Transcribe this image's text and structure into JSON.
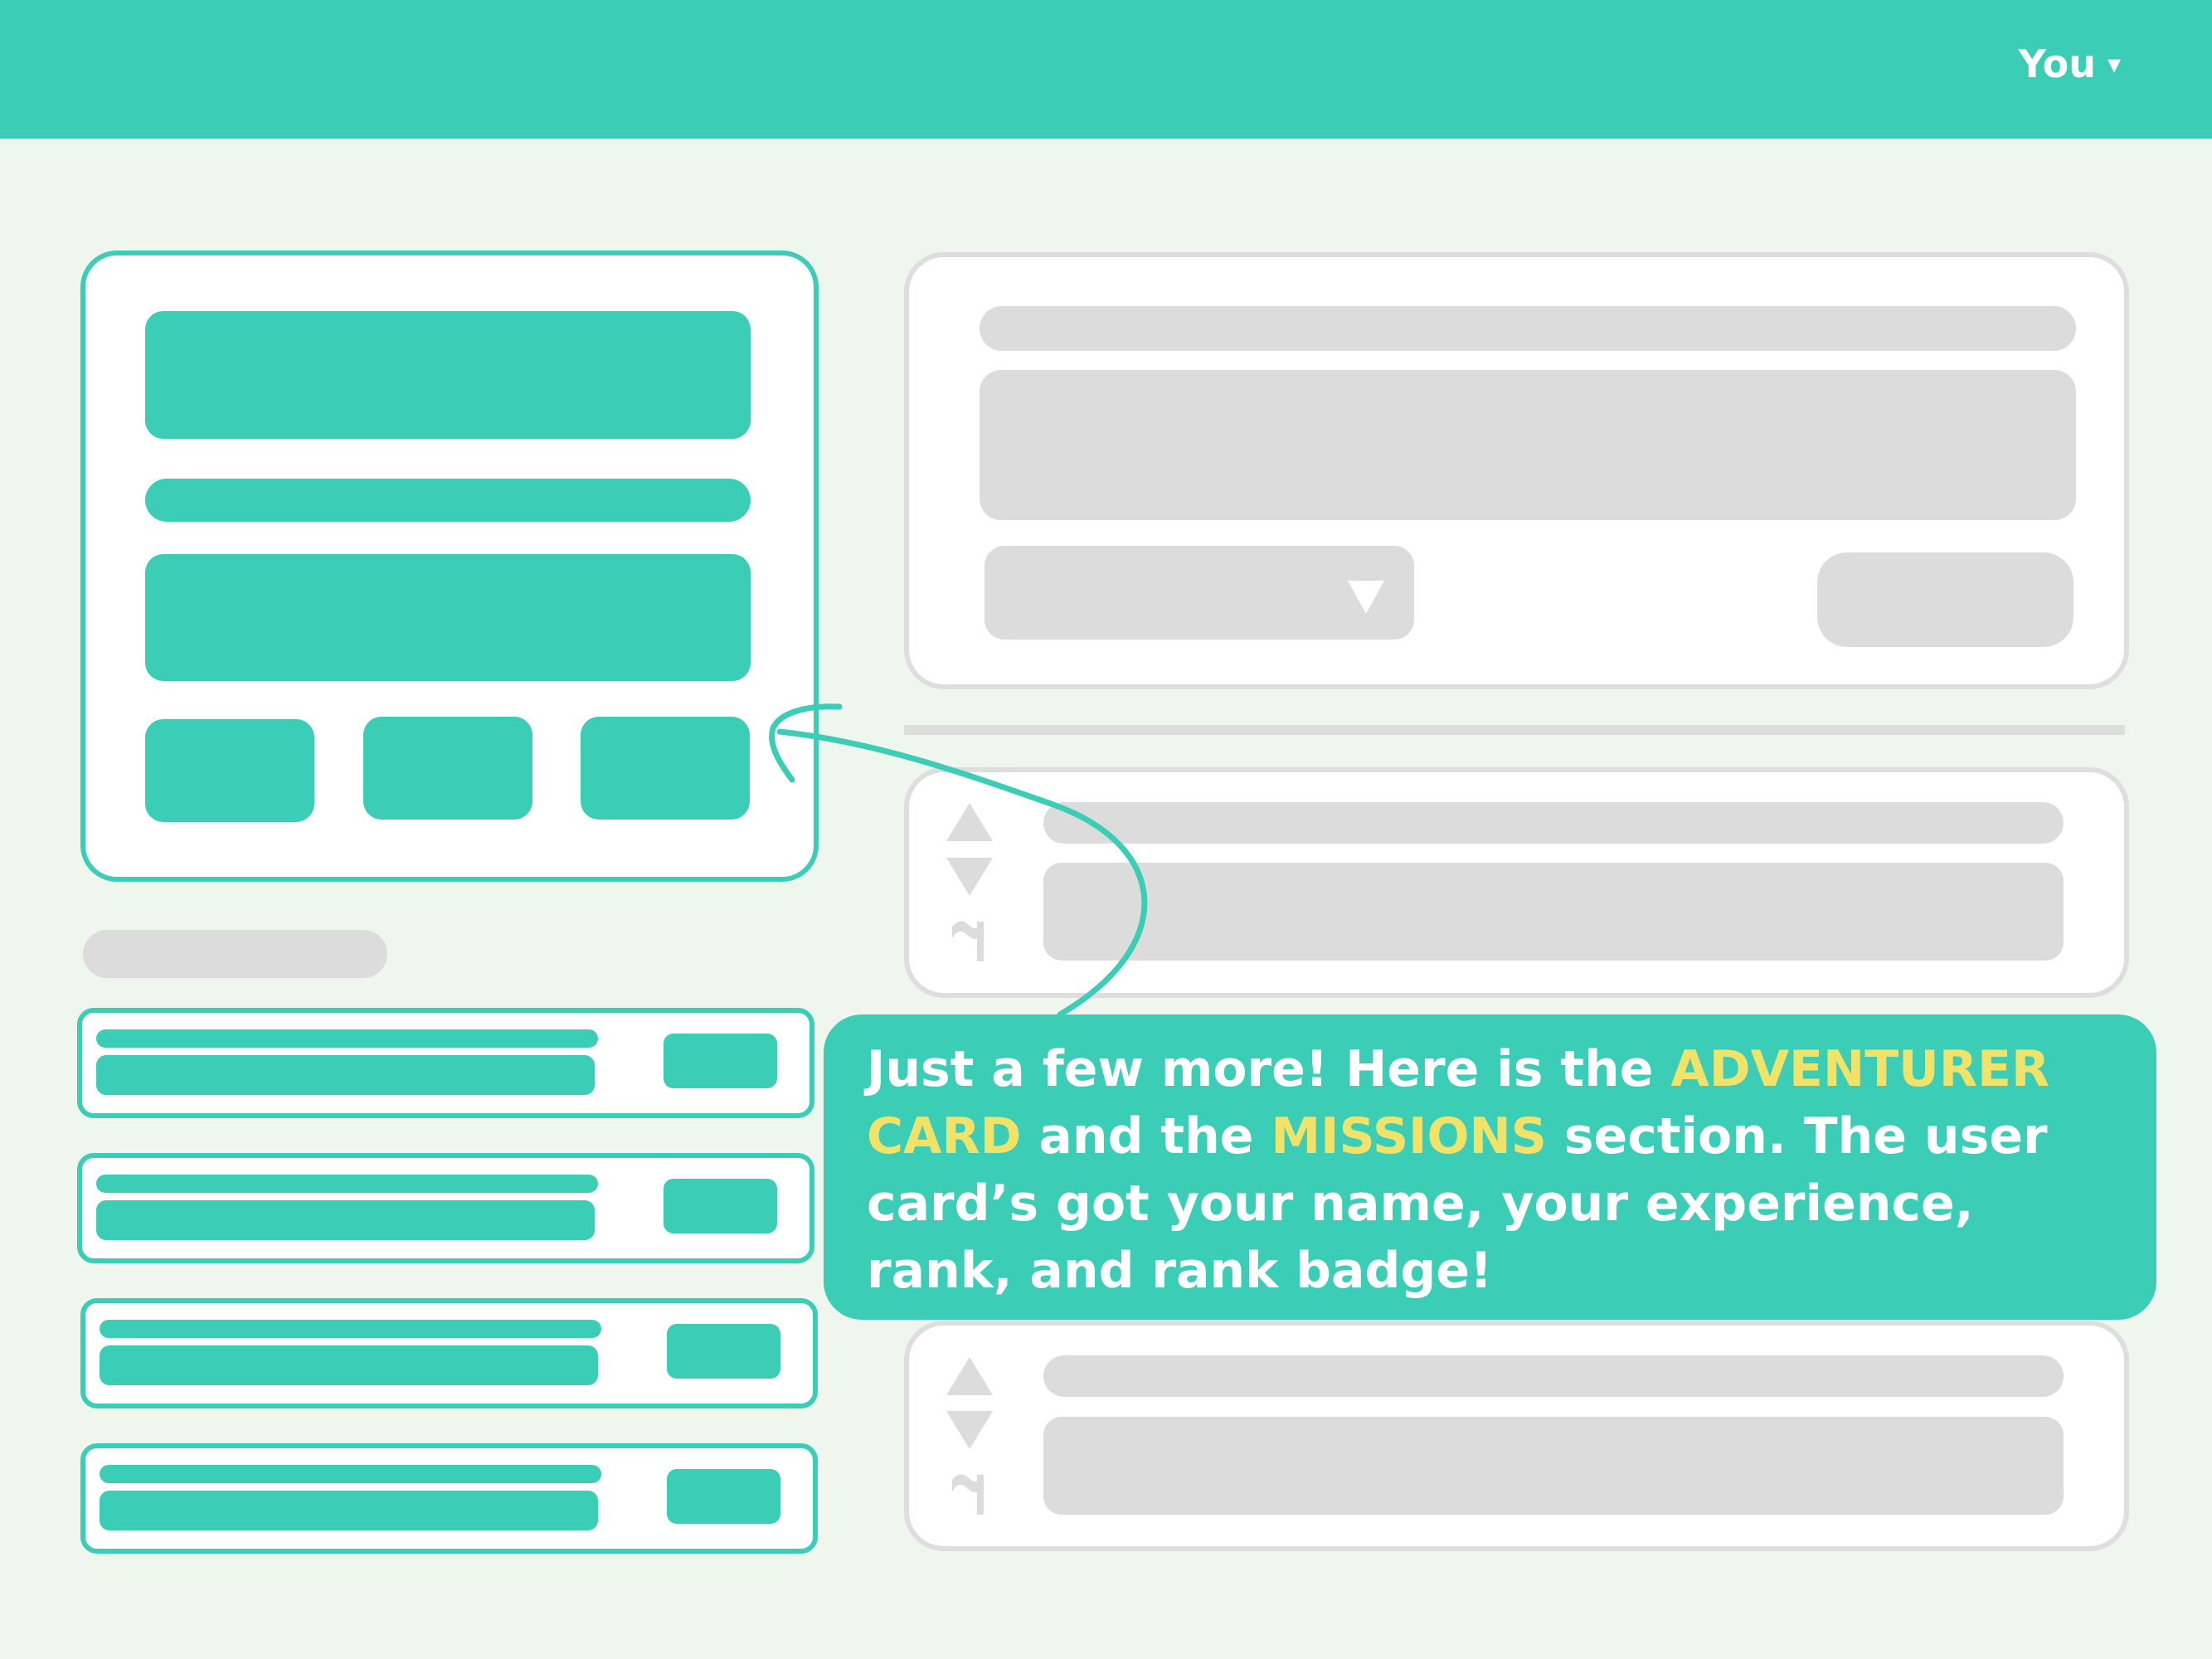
{
  "header": {
    "user_menu_label": "You",
    "user_menu_caret": "▾"
  },
  "tooltip": {
    "part1": "Just a few more! Here is the ",
    "highlight1": "ADVENTURER CARD",
    "part2": " and the ",
    "highlight2": "MISSIONS",
    "part3": " section. The user card’s got your name, your experience, rank, and rank badge!"
  },
  "icons": {
    "upvote": "triangle-up-icon",
    "downvote": "triangle-down-icon",
    "flag": "flag-icon",
    "dropdown": "triangle-down-icon",
    "pointer": "curved-arrow-icon"
  },
  "colors": {
    "accent": "#3bcdb5",
    "background": "#eef6ee",
    "placeholder": "#dcdcdc",
    "highlight": "#f1e36a"
  }
}
